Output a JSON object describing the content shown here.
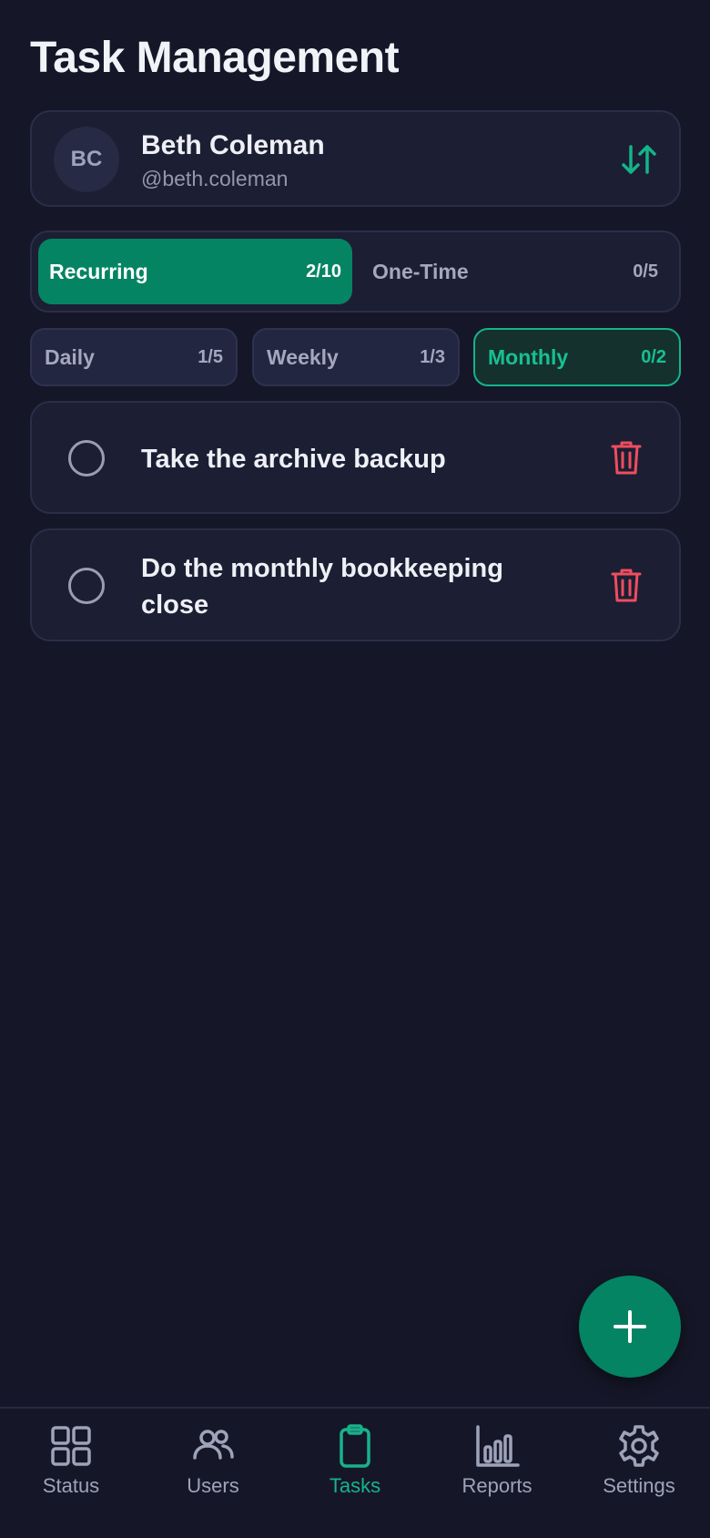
{
  "page": {
    "title": "Task Management"
  },
  "user": {
    "initials": "BC",
    "name": "Beth Coleman",
    "handle": "@beth.coleman"
  },
  "main_tabs": [
    {
      "label": "Recurring",
      "count": "2/10",
      "active": true
    },
    {
      "label": "One-Time",
      "count": "0/5",
      "active": false
    }
  ],
  "sub_tabs": [
    {
      "label": "Daily",
      "count": "1/5",
      "active": false
    },
    {
      "label": "Weekly",
      "count": "1/3",
      "active": false
    },
    {
      "label": "Monthly",
      "count": "0/2",
      "active": true
    }
  ],
  "tasks": [
    {
      "text": "Take the archive backup",
      "done": false
    },
    {
      "text": "Do the monthly bookkeeping close",
      "done": false
    }
  ],
  "nav": [
    {
      "label": "Status",
      "icon": "grid-icon",
      "active": false
    },
    {
      "label": "Users",
      "icon": "users-icon",
      "active": false
    },
    {
      "label": "Tasks",
      "icon": "clipboard-icon",
      "active": true
    },
    {
      "label": "Reports",
      "icon": "bar-chart-icon",
      "active": false
    },
    {
      "label": "Settings",
      "icon": "gear-icon",
      "active": false
    }
  ],
  "colors": {
    "background": "#151728",
    "accent": "#048463",
    "accent_text": "#18c08f",
    "danger": "#ef4d5e"
  }
}
